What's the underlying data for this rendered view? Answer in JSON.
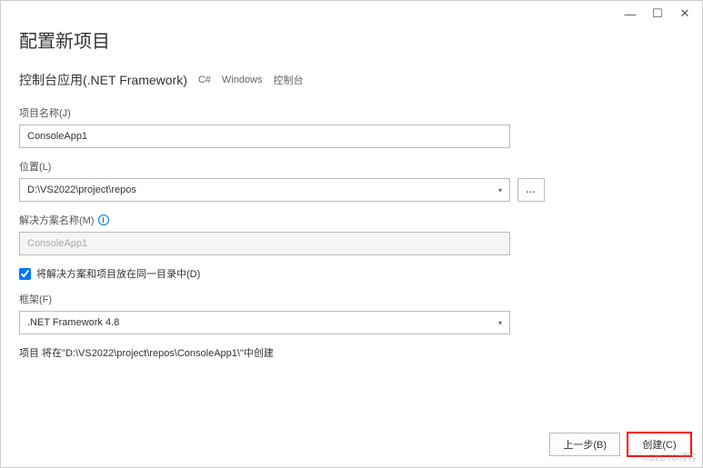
{
  "window": {
    "minimize": "—",
    "maximize": "☐",
    "close": "✕"
  },
  "heading": "配置新项目",
  "subtitle": "控制台应用(.NET Framework)",
  "tags": {
    "lang": "C#",
    "platform": "Windows",
    "type": "控制台"
  },
  "project_name": {
    "label": "项目名称(J)",
    "value": "ConsoleApp1"
  },
  "location": {
    "label": "位置(L)",
    "value": "D:\\VS2022\\project\\repos",
    "browse": "..."
  },
  "solution_name": {
    "label": "解决方案名称(M)",
    "value": "ConsoleApp1"
  },
  "same_dir": {
    "label": "将解决方案和项目放在同一目录中(D)",
    "checked": true
  },
  "framework": {
    "label": "框架(F)",
    "value": ".NET Framework 4.8"
  },
  "project_path_text": "项目 将在\"D:\\VS2022\\project\\repos\\ConsoleApp1\\\"中创建",
  "buttons": {
    "back": "上一步(B)",
    "create": "创建(C)"
  },
  "info_icon": "i",
  "watermark": "©51CTO博客"
}
